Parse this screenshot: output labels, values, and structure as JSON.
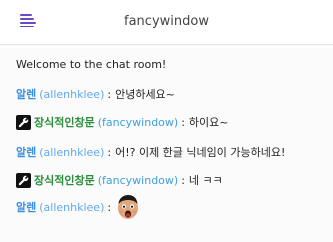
{
  "header": {
    "title": "fancywindow"
  },
  "messages": [
    {
      "type": "system",
      "text": "Welcome to the chat room!"
    },
    {
      "type": "user",
      "nick": "알렌",
      "id": "(allenhklee)",
      "sep": ":",
      "text": "안녕하세요~"
    },
    {
      "type": "admin",
      "nick": "장식적인창문",
      "id": "(fancywindow)",
      "sep": ":",
      "text": "하이요~"
    },
    {
      "type": "user",
      "nick": "알렌",
      "id": "(allenhklee)",
      "sep": ":",
      "text": "어!? 이제 한글 닉네임이 가능하네요!"
    },
    {
      "type": "admin",
      "nick": "장식적인창문",
      "id": "(fancywindow)",
      "sep": ":",
      "text": "네 ㅋㅋ"
    },
    {
      "type": "user",
      "nick": "알렌",
      "id": "(allenhklee)",
      "sep": ":",
      "emoji": "surprised-face"
    }
  ],
  "icons": {
    "menu": "hamburger-menu-icon",
    "admin_badge": "wrench-icon",
    "emoji": "surprised-face-emoji"
  },
  "colors": {
    "accent": "#6a4bc4",
    "user_nick": "#3b8ee0",
    "admin_nick": "#2a8d3a"
  }
}
